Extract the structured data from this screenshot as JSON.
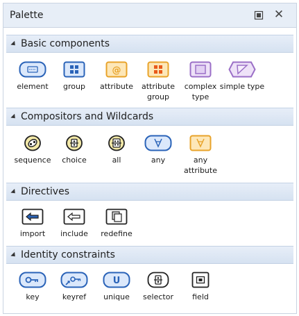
{
  "panel": {
    "title": "Palette"
  },
  "sections": [
    {
      "label": "Basic components",
      "items": [
        {
          "label": "element",
          "icon": "element-icon"
        },
        {
          "label": "group",
          "icon": "group-icon"
        },
        {
          "label": "attribute",
          "icon": "attribute-icon"
        },
        {
          "label": "attribute group",
          "icon": "attribute-group-icon"
        },
        {
          "label": "complex type",
          "icon": "complex-type-icon"
        },
        {
          "label": "simple type",
          "icon": "simple-type-icon"
        }
      ]
    },
    {
      "label": "Compositors and Wildcards",
      "items": [
        {
          "label": "sequence",
          "icon": "sequence-icon"
        },
        {
          "label": "choice",
          "icon": "choice-icon"
        },
        {
          "label": "all",
          "icon": "all-icon"
        },
        {
          "label": "any",
          "icon": "any-icon"
        },
        {
          "label": "any attribute",
          "icon": "any-attribute-icon"
        }
      ]
    },
    {
      "label": "Directives",
      "items": [
        {
          "label": "import",
          "icon": "import-icon"
        },
        {
          "label": "include",
          "icon": "include-icon"
        },
        {
          "label": "redefine",
          "icon": "redefine-icon"
        }
      ]
    },
    {
      "label": "Identity constraints",
      "items": [
        {
          "label": "key",
          "icon": "key-icon"
        },
        {
          "label": "keyref",
          "icon": "keyref-icon"
        },
        {
          "label": "unique",
          "icon": "unique-icon"
        },
        {
          "label": "selector",
          "icon": "selector-icon"
        },
        {
          "label": "field",
          "icon": "field-icon"
        }
      ]
    }
  ],
  "colors": {
    "blue": "#2a63b8",
    "blueFill": "#dbe8fb",
    "orange": "#e8a32a",
    "orangeFill": "#fde7b8",
    "purple": "#9b6fc7",
    "purpleFill": "#eee2f8",
    "dark": "#222222"
  }
}
